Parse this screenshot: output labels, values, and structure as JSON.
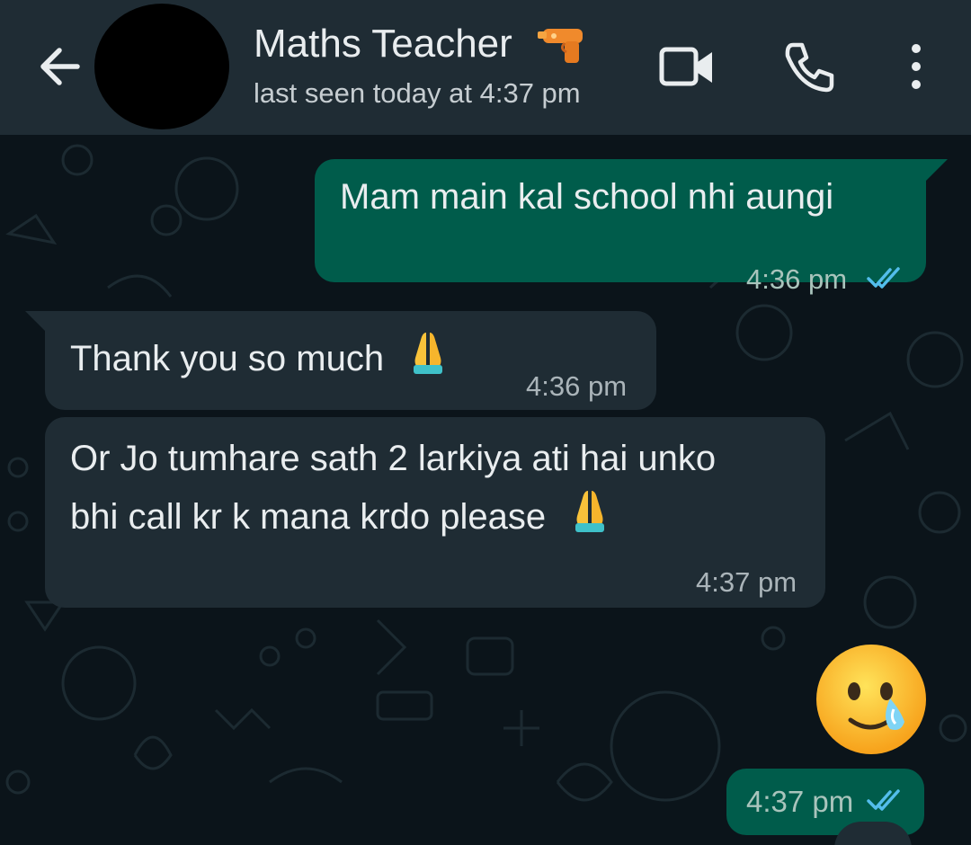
{
  "header": {
    "contact_name": "Maths Teacher",
    "contact_emoji": "water-pistol-icon",
    "status": "last seen today at 4:37 pm",
    "icons": [
      "back-arrow-icon",
      "video-camera-icon",
      "phone-icon",
      "more-vertical-icon"
    ]
  },
  "messages": [
    {
      "direction": "outgoing",
      "text": "Mam main kal school nhi aungi",
      "time": "4:36 pm",
      "status": "read"
    },
    {
      "direction": "incoming",
      "text": "Thank you so much",
      "emoji": "folded-hands-icon",
      "time": "4:36 pm"
    },
    {
      "direction": "incoming",
      "lines": [
        "Or Jo tumhare sath 2 larkiya ati hai unko",
        "bhi call kr k mana krdo please"
      ],
      "emoji": "folded-hands-icon",
      "time": "4:37 pm"
    },
    {
      "direction": "outgoing",
      "sticker": "crying-face-icon",
      "time": "4:37 pm",
      "status": "read"
    }
  ],
  "colors": {
    "header_bg": "#1f2c34",
    "chat_bg": "#0b141a",
    "outgoing_bubble": "#005c4b",
    "incoming_bubble": "#1f2c34",
    "read_tick": "#53bdeb"
  }
}
